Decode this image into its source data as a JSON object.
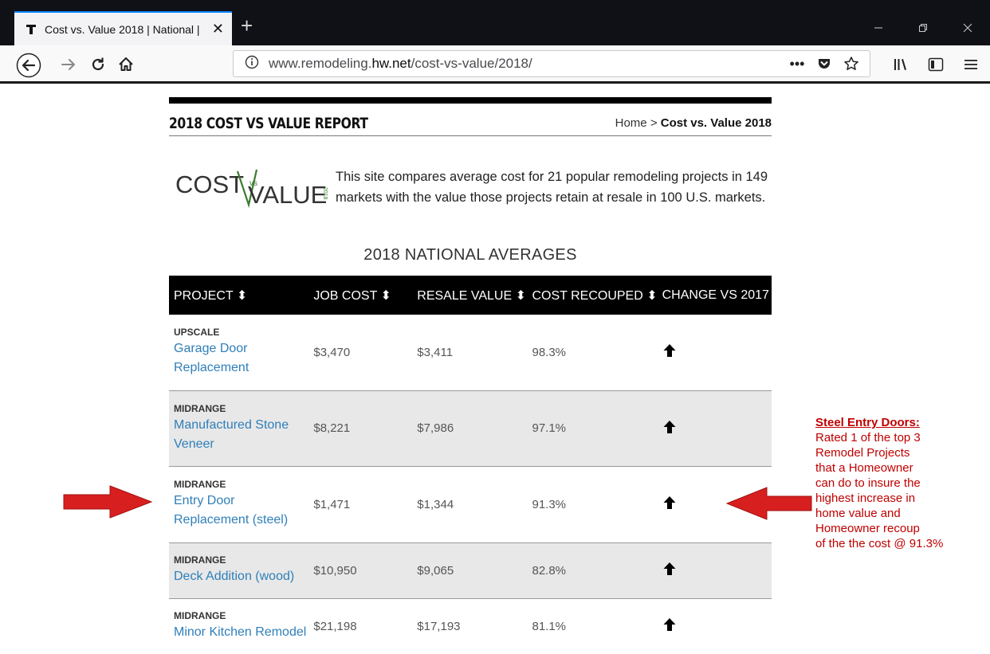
{
  "browser": {
    "tab_title": "Cost vs. Value 2018 | National | ",
    "new_tab": "+",
    "url_prefix": "www.remodeling.",
    "url_domain": "hw.net",
    "url_path": "/cost-vs-value/2018/",
    "more_actions": "•••"
  },
  "page": {
    "report_title": "2018 COST VS VALUE REPORT",
    "breadcrumb_home": "Home",
    "breadcrumb_sep": ">",
    "breadcrumb_current": "Cost vs. Value 2018",
    "logo": {
      "cost": "COST",
      "vs": "vs",
      "value": "VALUE",
      "year": "2018"
    },
    "intro_line1": "This site compares average cost for 21 popular remodeling projects in 149",
    "intro_line2": "markets with the value those projects retain at resale in 100 U.S. markets.",
    "averages_title": "2018 NATIONAL AVERAGES",
    "columns": [
      "PROJECT",
      "JOB COST",
      "RESALE VALUE",
      "COST RECOUPED",
      "CHANGE VS 2017"
    ],
    "sort_glyph": "⬍",
    "rows": [
      {
        "tier": "UPSCALE",
        "project_line1": "Garage Door",
        "project_line2": "Replacement",
        "job_cost": "$3,470",
        "resale": "$3,411",
        "recouped": "98.3%",
        "change": "up"
      },
      {
        "tier": "MIDRANGE",
        "project_line1": "Manufactured Stone",
        "project_line2": "Veneer",
        "job_cost": "$8,221",
        "resale": "$7,986",
        "recouped": "97.1%",
        "change": "up"
      },
      {
        "tier": "MIDRANGE",
        "project_line1": "Entry Door",
        "project_line2": "Replacement (steel)",
        "job_cost": "$1,471",
        "resale": "$1,344",
        "recouped": "91.3%",
        "change": "up"
      },
      {
        "tier": "MIDRANGE",
        "project_line1": "Deck Addition (wood)",
        "project_line2": "",
        "job_cost": "$10,950",
        "resale": "$9,065",
        "recouped": "82.8%",
        "change": "up"
      },
      {
        "tier": "MIDRANGE",
        "project_line1": "Minor Kitchen Remodel",
        "project_line2": "",
        "job_cost": "$21,198",
        "resale": "$17,193",
        "recouped": "81.1%",
        "change": "up"
      }
    ]
  },
  "annotation": {
    "title": "Steel Entry Doors:",
    "lines": [
      "Rated 1 of the top 3",
      "Remodel Projects",
      "that a Homeowner",
      "can do to insure the",
      "highest increase in",
      "home value and",
      "Homeowner recoup",
      "of the the cost @ 91.3%"
    ],
    "color": "#c00000"
  },
  "colors": {
    "link": "#2f7fb9",
    "accent_tab": "#0a84ff",
    "logo_green": "#3a7d2f",
    "logo_gray": "#333333",
    "annotation_arrow": "#d81f1f"
  }
}
